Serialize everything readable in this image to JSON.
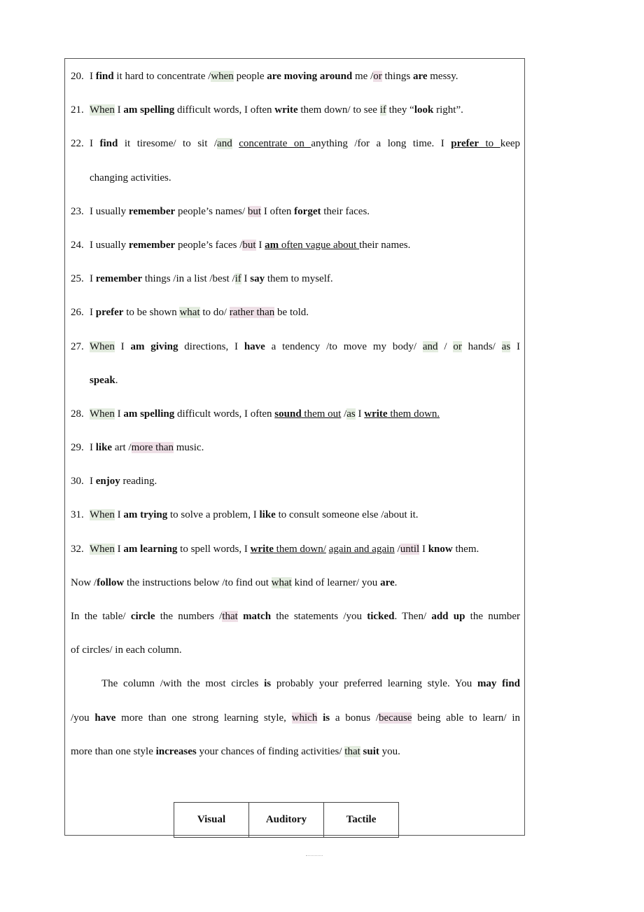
{
  "items": [
    {
      "num": "20.",
      "lines": [
        [
          {
            "t": "I "
          },
          {
            "t": "find",
            "f": "b"
          },
          {
            "t": " it hard to concentrate /"
          },
          {
            "t": "when",
            "f": "hg"
          },
          {
            "t": " people "
          },
          {
            "t": "are moving around",
            "f": "b"
          },
          {
            "t": " me /"
          },
          {
            "t": "or",
            "f": "hp"
          },
          {
            "t": " things "
          },
          {
            "t": "are",
            "f": "b"
          },
          {
            "t": " messy."
          }
        ]
      ]
    },
    {
      "num": "21.",
      "lines": [
        [
          {
            "t": "When",
            "f": "hg"
          },
          {
            "t": " I "
          },
          {
            "t": "am spelling",
            "f": "b"
          },
          {
            "t": " difficult words, I often "
          },
          {
            "t": "write",
            "f": "b"
          },
          {
            "t": " them down/ to see "
          },
          {
            "t": "if",
            "f": "hg"
          },
          {
            "t": " they “"
          },
          {
            "t": "look",
            "f": "b"
          },
          {
            "t": " right”."
          }
        ]
      ]
    },
    {
      "num": "22.",
      "lines": [
        [
          {
            "t": "I "
          },
          {
            "t": "find",
            "f": "b"
          },
          {
            "t": " it tiresome/ to sit /"
          },
          {
            "t": "and",
            "f": "hg"
          },
          {
            "t": " "
          },
          {
            "t": "concentrate on ",
            "f": "u"
          },
          {
            "t": "anything /for a long time. I "
          },
          {
            "t": "prefer",
            "f": "bu"
          },
          {
            "t": " to ",
            "f": "u"
          },
          {
            "t": "keep"
          }
        ],
        [
          {
            "t": "changing activities."
          }
        ]
      ],
      "justify": [
        true,
        false
      ]
    },
    {
      "num": "23.",
      "lines": [
        [
          {
            "t": "I usually "
          },
          {
            "t": "remember",
            "f": "b"
          },
          {
            "t": " people’s names/ "
          },
          {
            "t": "but",
            "f": "hp"
          },
          {
            "t": " I often "
          },
          {
            "t": "forget",
            "f": "b"
          },
          {
            "t": " their faces."
          }
        ]
      ]
    },
    {
      "num": "24.",
      "lines": [
        [
          {
            "t": "I usually "
          },
          {
            "t": "remember",
            "f": "b"
          },
          {
            "t": " people’s faces /"
          },
          {
            "t": "but",
            "f": "hp"
          },
          {
            "t": " I "
          },
          {
            "t": "am",
            "f": "bu"
          },
          {
            "t": " often vague about ",
            "f": "u"
          },
          {
            "t": "their names."
          }
        ]
      ]
    },
    {
      "num": "25.",
      "lines": [
        [
          {
            "t": "I "
          },
          {
            "t": "remember",
            "f": "b"
          },
          {
            "t": " things /in a list /best /"
          },
          {
            "t": "if",
            "f": "hg"
          },
          {
            "t": " I "
          },
          {
            "t": "say",
            "f": "b"
          },
          {
            "t": " them to myself."
          }
        ]
      ]
    },
    {
      "num": "26.",
      "lines": [
        [
          {
            "t": "I "
          },
          {
            "t": "prefer",
            "f": "b"
          },
          {
            "t": " to be shown "
          },
          {
            "t": "what",
            "f": "hg"
          },
          {
            "t": " to do/ "
          },
          {
            "t": "rather than",
            "f": "hp"
          },
          {
            "t": " be told."
          }
        ]
      ]
    },
    {
      "num": "27.",
      "lines": [
        [
          {
            "t": "When",
            "f": "hg"
          },
          {
            "t": " I "
          },
          {
            "t": "am giving",
            "f": "b"
          },
          {
            "t": " directions, I "
          },
          {
            "t": "have",
            "f": "b"
          },
          {
            "t": " a tendency /to move my body/ "
          },
          {
            "t": "and",
            "f": "hg"
          },
          {
            "t": " / "
          },
          {
            "t": "or",
            "f": "hg"
          },
          {
            "t": " hands/ "
          },
          {
            "t": "as",
            "f": "hg"
          },
          {
            "t": " I"
          }
        ],
        [
          {
            "t": "speak",
            "f": "b"
          },
          {
            "t": "."
          }
        ]
      ],
      "justify": [
        true,
        false
      ]
    },
    {
      "num": "28.",
      "lines": [
        [
          {
            "t": "When",
            "f": "hg"
          },
          {
            "t": " I "
          },
          {
            "t": "am spelling",
            "f": "b"
          },
          {
            "t": " difficult words, I often "
          },
          {
            "t": "sound",
            "f": "bu"
          },
          {
            "t": " them out",
            "f": "u"
          },
          {
            "t": " /"
          },
          {
            "t": "as",
            "f": "hg"
          },
          {
            "t": " I "
          },
          {
            "t": "write",
            "f": "bu"
          },
          {
            "t": " them down.",
            "f": "u"
          }
        ]
      ]
    },
    {
      "num": "29.",
      "lines": [
        [
          {
            "t": "I "
          },
          {
            "t": "like",
            "f": "b"
          },
          {
            "t": " art /"
          },
          {
            "t": "more than",
            "f": "hp"
          },
          {
            "t": " music."
          }
        ]
      ]
    },
    {
      "num": "30.",
      "lines": [
        [
          {
            "t": "I "
          },
          {
            "t": "enjoy",
            "f": "b"
          },
          {
            "t": " reading."
          }
        ]
      ]
    },
    {
      "num": "31.",
      "lines": [
        [
          {
            "t": "When",
            "f": "hg"
          },
          {
            "t": " I "
          },
          {
            "t": "am trying",
            "f": "b"
          },
          {
            "t": " to solve a problem, I "
          },
          {
            "t": "like",
            "f": "b"
          },
          {
            "t": " to consult someone else /about it."
          }
        ]
      ]
    },
    {
      "num": "32.",
      "lines": [
        [
          {
            "t": "When",
            "f": "hg"
          },
          {
            "t": " I "
          },
          {
            "t": "am learning",
            "f": "b"
          },
          {
            "t": " to spell words, I "
          },
          {
            "t": "write",
            "f": "bu"
          },
          {
            "t": " them down/",
            "f": "u"
          },
          {
            "t": " "
          },
          {
            "t": "again and again",
            "f": "u"
          },
          {
            "t": " /"
          },
          {
            "t": "until",
            "f": "hp"
          },
          {
            "t": " I "
          },
          {
            "t": "know",
            "f": "b"
          },
          {
            "t": " them."
          }
        ]
      ]
    }
  ],
  "paragraphs": [
    {
      "lines": [
        [
          {
            "t": "Now /"
          },
          {
            "t": "follow",
            "f": "b"
          },
          {
            "t": " the instructions below /to find out "
          },
          {
            "t": "what",
            "f": "hg"
          },
          {
            "t": " kind of learner/ you "
          },
          {
            "t": "are",
            "f": "b"
          },
          {
            "t": "."
          }
        ]
      ]
    },
    {
      "lines": [
        [
          {
            "t": "In the table/ "
          },
          {
            "t": "circle",
            "f": "b"
          },
          {
            "t": " the numbers /"
          },
          {
            "t": "that",
            "f": "hp"
          },
          {
            "t": " "
          },
          {
            "t": "match",
            "f": "b"
          },
          {
            "t": " the statements /you "
          },
          {
            "t": "ticked",
            "f": "b"
          },
          {
            "t": ". Then/ "
          },
          {
            "t": "add up",
            "f": "b"
          },
          {
            "t": " the number"
          }
        ],
        [
          {
            "t": "of circles/ in each column."
          }
        ]
      ],
      "justify": [
        true,
        false
      ]
    },
    {
      "indent": true,
      "lines": [
        [
          {
            "t": "The column /with the most circles "
          },
          {
            "t": "is",
            "f": "b"
          },
          {
            "t": " probably your preferred learning style. You "
          },
          {
            "t": "may find",
            "f": "b"
          }
        ],
        [
          {
            "t": "/you "
          },
          {
            "t": "have",
            "f": "b"
          },
          {
            "t": " more than one strong learning style, "
          },
          {
            "t": "which",
            "f": "hp"
          },
          {
            "t": " "
          },
          {
            "t": "is",
            "f": "b"
          },
          {
            "t": " a bonus /"
          },
          {
            "t": "because",
            "f": "hp"
          },
          {
            "t": " being able to learn/ in"
          }
        ],
        [
          {
            "t": "more than one style "
          },
          {
            "t": "increases",
            "f": "b"
          },
          {
            "t": " your chances of finding activities/ "
          },
          {
            "t": "that",
            "f": "hg"
          },
          {
            "t": " "
          },
          {
            "t": "suit",
            "f": "b"
          },
          {
            "t": " you."
          }
        ]
      ],
      "justify": [
        true,
        true,
        false
      ]
    }
  ],
  "table": {
    "headers": [
      "Visual",
      "Auditory",
      "Tactile"
    ]
  }
}
